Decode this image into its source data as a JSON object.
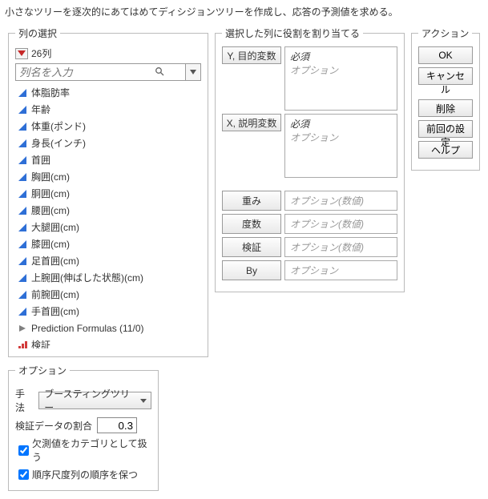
{
  "description": "小さなツリーを逐次的にあてはめてディシジョンツリーを作成し、応答の予測値を求める。",
  "colSelect": {
    "legend": "列の選択",
    "count": "26列",
    "searchPlaceholder": "列名を入力",
    "items": [
      {
        "icon": "cont",
        "label": "体脂肪率"
      },
      {
        "icon": "cont",
        "label": "年齢"
      },
      {
        "icon": "cont",
        "label": "体重(ポンド)"
      },
      {
        "icon": "cont",
        "label": "身長(インチ)"
      },
      {
        "icon": "cont",
        "label": "首囲"
      },
      {
        "icon": "cont",
        "label": "胸囲(cm)"
      },
      {
        "icon": "cont",
        "label": "胴囲(cm)"
      },
      {
        "icon": "cont",
        "label": "腰囲(cm)"
      },
      {
        "icon": "cont",
        "label": "大腿囲(cm)"
      },
      {
        "icon": "cont",
        "label": "膝囲(cm)"
      },
      {
        "icon": "cont",
        "label": "足首囲(cm)"
      },
      {
        "icon": "cont",
        "label": "上腕囲(伸ばした状態)(cm)"
      },
      {
        "icon": "cont",
        "label": "前腕囲(cm)"
      },
      {
        "icon": "cont",
        "label": "手首囲(cm)"
      },
      {
        "icon": "group",
        "label": "Prediction Formulas (11/0)"
      },
      {
        "icon": "nom",
        "label": "検証"
      }
    ]
  },
  "rolePanel": {
    "legend": "選択した列に役割を割り当てる",
    "roles": [
      {
        "btn": "Y, 目的変数",
        "box": [
          "必須",
          "オプション"
        ],
        "tall": true
      },
      {
        "btn": "X, 説明変数",
        "box": [
          "必須",
          "オプション"
        ],
        "tall": true
      },
      {
        "btn": "重み",
        "box": [
          "オプション(数値)"
        ],
        "tall": false
      },
      {
        "btn": "度数",
        "box": [
          "オプション(数値)"
        ],
        "tall": false
      },
      {
        "btn": "検証",
        "box": [
          "オプション(数値)"
        ],
        "tall": false
      },
      {
        "btn": "By",
        "box": [
          "オプション"
        ],
        "tall": false
      }
    ]
  },
  "actions": {
    "legend": "アクション",
    "ok": "OK",
    "cancel": "キャンセル",
    "remove": "削除",
    "recall": "前回の設定",
    "help": "ヘルプ"
  },
  "options": {
    "legend": "オプション",
    "methodLabel": "手法",
    "methodValue": "ブースティングツリー",
    "ratioLabel": "検証データの割合",
    "ratioValue": "0.3",
    "chk1": "欠測値をカテゴリとして扱う",
    "chk2": "順序尺度列の順序を保つ"
  }
}
